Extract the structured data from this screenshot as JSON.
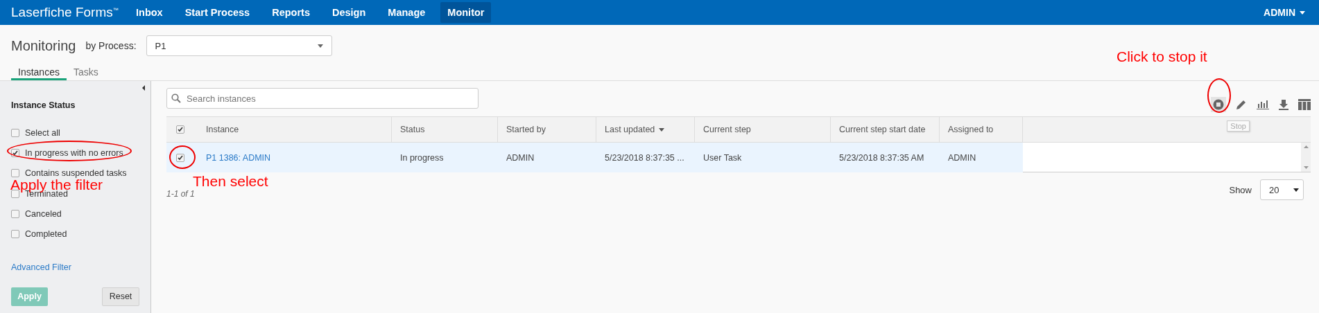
{
  "nav": {
    "logo": "Laserfiche Forms",
    "logo_mark": "™",
    "items": [
      {
        "label": "Inbox",
        "selected": false
      },
      {
        "label": "Start Process",
        "selected": false
      },
      {
        "label": "Reports",
        "selected": false
      },
      {
        "label": "Design",
        "selected": false
      },
      {
        "label": "Manage",
        "selected": false
      },
      {
        "label": "Monitor",
        "selected": true
      }
    ],
    "user": "ADMIN"
  },
  "header": {
    "title": "Monitoring",
    "process_label": "by Process:",
    "process_value": "P1"
  },
  "tabs": [
    {
      "label": "Instances",
      "selected": true
    },
    {
      "label": "Tasks",
      "selected": false
    }
  ],
  "sidebar": {
    "heading": "Instance Status",
    "filters": [
      {
        "label": "Select all",
        "checked": false
      },
      {
        "label": "In progress with no errors",
        "checked": true
      },
      {
        "label": "Contains suspended tasks",
        "checked": false
      },
      {
        "label": "Terminated",
        "checked": false
      },
      {
        "label": "Canceled",
        "checked": false
      },
      {
        "label": "Completed",
        "checked": false
      }
    ],
    "advanced_link": "Advanced Filter",
    "apply": {
      "label": "Apply",
      "disabled": true
    },
    "reset": "Reset"
  },
  "search": {
    "placeholder": "Search instances"
  },
  "toolbar": {
    "tooltip": "Stop"
  },
  "table": {
    "select_all_checked": true,
    "columns": [
      {
        "label": "Instance",
        "sorted": false
      },
      {
        "label": "Status",
        "sorted": false
      },
      {
        "label": "Started by",
        "sorted": false
      },
      {
        "label": "Last updated",
        "sorted": true
      },
      {
        "label": "Current step",
        "sorted": false
      },
      {
        "label": "Current step start date",
        "sorted": false
      },
      {
        "label": "Assigned to",
        "sorted": false
      }
    ],
    "rows": [
      {
        "checked": true,
        "selected": true,
        "cells": [
          "P1 1386: ADMIN",
          "In progress",
          "ADMIN",
          "5/23/2018 8:37:35 ...",
          "User Task",
          "5/23/2018 8:37:35 AM",
          "ADMIN"
        ]
      }
    ]
  },
  "pagination": {
    "summary": "1-1 of 1",
    "show_label": "Show",
    "page_size": "20"
  },
  "annotations": [
    {
      "text": "Click to stop it"
    },
    {
      "text": "Apply the filter"
    },
    {
      "text": "Then select"
    }
  ]
}
